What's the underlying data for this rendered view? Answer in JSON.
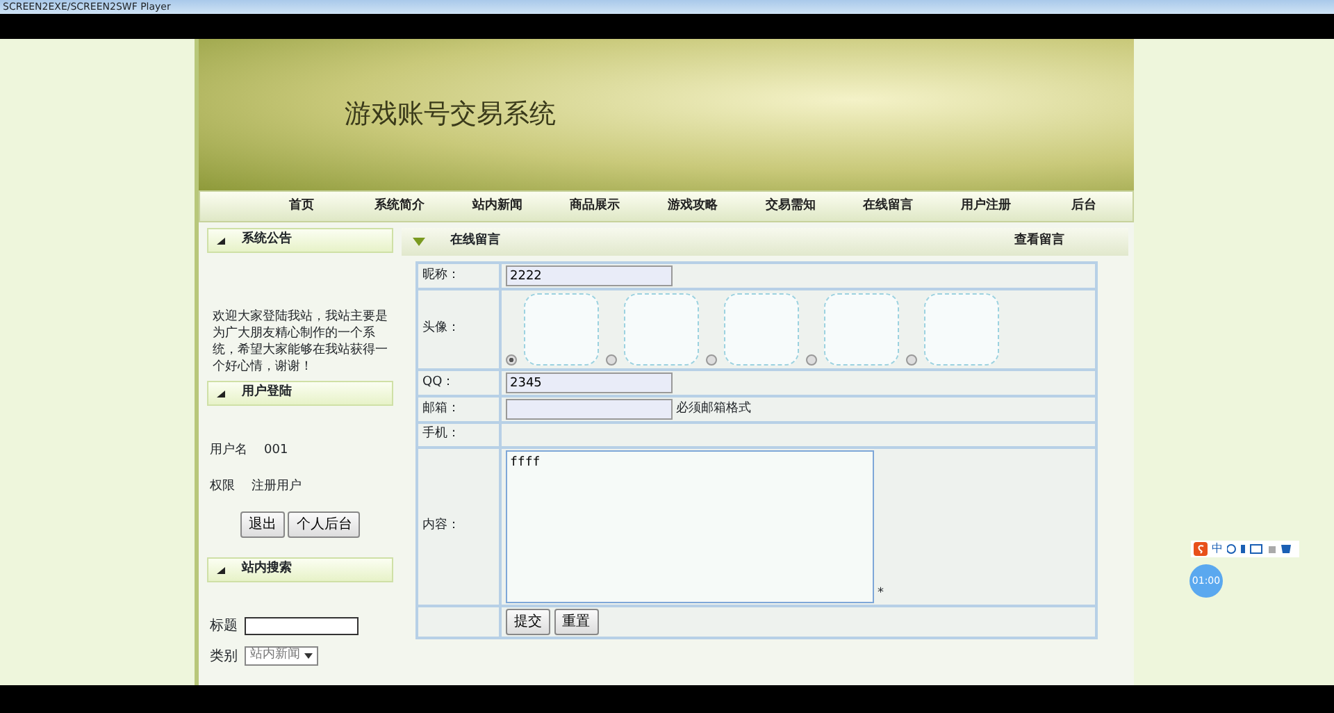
{
  "window": {
    "title": "SCREEN2EXE/SCREEN2SWF Player"
  },
  "site": {
    "title": "游戏账号交易系统"
  },
  "nav": [
    {
      "label": "首页"
    },
    {
      "label": "系统简介"
    },
    {
      "label": "站内新闻"
    },
    {
      "label": "商品展示"
    },
    {
      "label": "游戏攻略"
    },
    {
      "label": "交易需知"
    },
    {
      "label": "在线留言"
    },
    {
      "label": "用户注册"
    },
    {
      "label": "后台"
    }
  ],
  "sidebar": {
    "notice": {
      "title": "系统公告",
      "text": "欢迎大家登陆我站，我站主要是为广大朋友精心制作的一个系统，希望大家能够在我站获得一个好心情，谢谢！"
    },
    "login": {
      "title": "用户登陆",
      "fields": [
        {
          "label": "用户名",
          "value": "001"
        },
        {
          "label": "权限",
          "value": "注册用户"
        }
      ],
      "buttons": [
        "退出",
        "个人后台"
      ]
    },
    "search": {
      "title": "站内搜索",
      "title_label": "标题",
      "category_label": "类别",
      "category_value": "站内新闻"
    }
  },
  "content": {
    "title": "在线留言",
    "link": "查看留言",
    "form": {
      "nickname": {
        "label": "昵称：",
        "value": "2222"
      },
      "avatar": {
        "label": "头像：",
        "options": [
          {
            "selected": true
          },
          {
            "selected": false
          },
          {
            "selected": false
          },
          {
            "selected": false
          },
          {
            "selected": false
          }
        ]
      },
      "qq": {
        "label": "QQ：",
        "value": "2345"
      },
      "email": {
        "label": "邮箱：",
        "hint": "必须邮箱格式"
      },
      "phone": {
        "label": "手机："
      },
      "message": {
        "label": "内容：",
        "value": "ffff",
        "required_mark": "*"
      },
      "buttons": [
        "提交",
        "重置"
      ]
    }
  },
  "ime": {
    "label": "中"
  },
  "timer": {
    "label": "01:00"
  }
}
